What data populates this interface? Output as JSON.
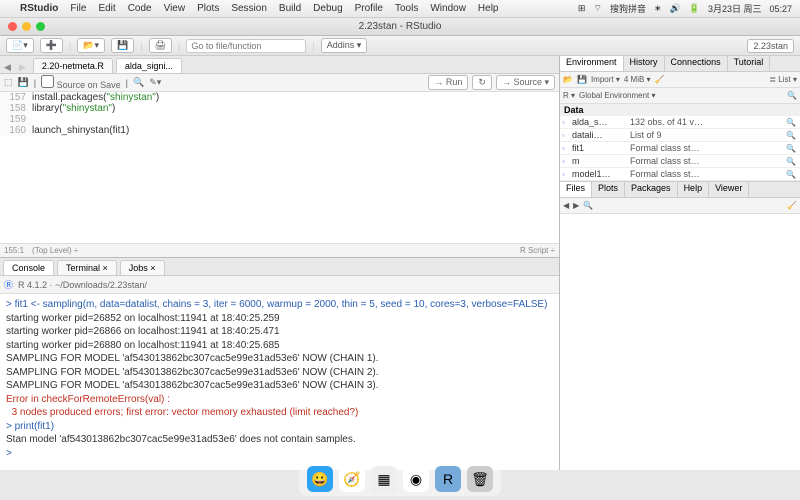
{
  "menubar": {
    "app": "RStudio",
    "items": [
      "File",
      "Edit",
      "Code",
      "View",
      "Plots",
      "Session",
      "Build",
      "Debug",
      "Profile",
      "Tools",
      "Window",
      "Help"
    ],
    "right": {
      "ime": "搜狗拼音",
      "date": "3月23日 周三",
      "time": "05:27"
    }
  },
  "window": {
    "title": "2.23stan - RStudio",
    "badge": "2.23stan"
  },
  "toolbar": {
    "goto_placeholder": "Go to file/function",
    "addins": "Addins ▾"
  },
  "source": {
    "tabs": [
      {
        "label": "2.20-netmeta.R"
      },
      {
        "label": "alda_signi..."
      }
    ],
    "source_on_save": "Source on Save",
    "run": "→ Run",
    "source_btn": "→ Source ▾",
    "lines": [
      {
        "n": "157",
        "code": "install.packages(\"shinystan\")"
      },
      {
        "n": "158",
        "code": "library(\"shinystan\")"
      },
      {
        "n": "159",
        "code": ""
      },
      {
        "n": "160",
        "code": "launch_shinystan(fit1)"
      }
    ],
    "status_left": "155:1",
    "status_mid": "(Top Level) ÷",
    "status_right": "R Script ÷"
  },
  "console": {
    "tabs": [
      "Console",
      "Terminal ×",
      "Jobs ×"
    ],
    "prompt_path": "R 4.1.2 · ~/Downloads/2.23stan/",
    "lines": [
      {
        "cls": "blue",
        "t": "> fit1 <- sampling(m, data=datalist, chains = 3, iter = 6000, warmup = 2000, thin = 5, seed = 10, cores=3, verbose=FALSE)"
      },
      {
        "cls": "",
        "t": "starting worker pid=26852 on localhost:11941 at 18:40:25.259"
      },
      {
        "cls": "",
        "t": "starting worker pid=26866 on localhost:11941 at 18:40:25.471"
      },
      {
        "cls": "",
        "t": "starting worker pid=26880 on localhost:11941 at 18:40:25.685"
      },
      {
        "cls": "",
        "t": ""
      },
      {
        "cls": "",
        "t": "SAMPLING FOR MODEL 'af543013862bc307cac5e99e31ad53e6' NOW (CHAIN 1)."
      },
      {
        "cls": "",
        "t": ""
      },
      {
        "cls": "",
        "t": "SAMPLING FOR MODEL 'af543013862bc307cac5e99e31ad53e6' NOW (CHAIN 2)."
      },
      {
        "cls": "",
        "t": ""
      },
      {
        "cls": "",
        "t": "SAMPLING FOR MODEL 'af543013862bc307cac5e99e31ad53e6' NOW (CHAIN 3)."
      },
      {
        "cls": "err",
        "t": "Error in checkForRemoteErrors(val) :"
      },
      {
        "cls": "err",
        "t": "  3 nodes produced errors; first error: vector memory exhausted (limit reached?)"
      },
      {
        "cls": "blue",
        "t": "> print(fit1)"
      },
      {
        "cls": "",
        "t": "Stan model 'af543013862bc307cac5e99e31ad53e6' does not contain samples."
      },
      {
        "cls": "blue",
        "t": ">"
      }
    ]
  },
  "env": {
    "tabs": [
      "Environment",
      "History",
      "Connections",
      "Tutorial"
    ],
    "import": "Import ▾",
    "mem": "4 MiB ▾",
    "list": "≣ List ▾",
    "scope": "R ▾",
    "globalenv": "Global Environment ▾",
    "section": "Data",
    "rows": [
      {
        "name": "alda_s…",
        "val": "132 obs. of 41 v…"
      },
      {
        "name": "datali…",
        "val": "List of  9"
      },
      {
        "name": "fit1",
        "val": "Formal class  st…"
      },
      {
        "name": "m",
        "val": "Formal class  st…"
      },
      {
        "name": "model1…",
        "val": "Formal class  st…"
      }
    ]
  },
  "files": {
    "tabs": [
      "Files",
      "Plots",
      "Packages",
      "Help",
      "Viewer"
    ]
  },
  "dock": {
    "icons": [
      "finder",
      "safari",
      "launchpad",
      "chrome",
      "rstudio",
      "trash"
    ]
  }
}
